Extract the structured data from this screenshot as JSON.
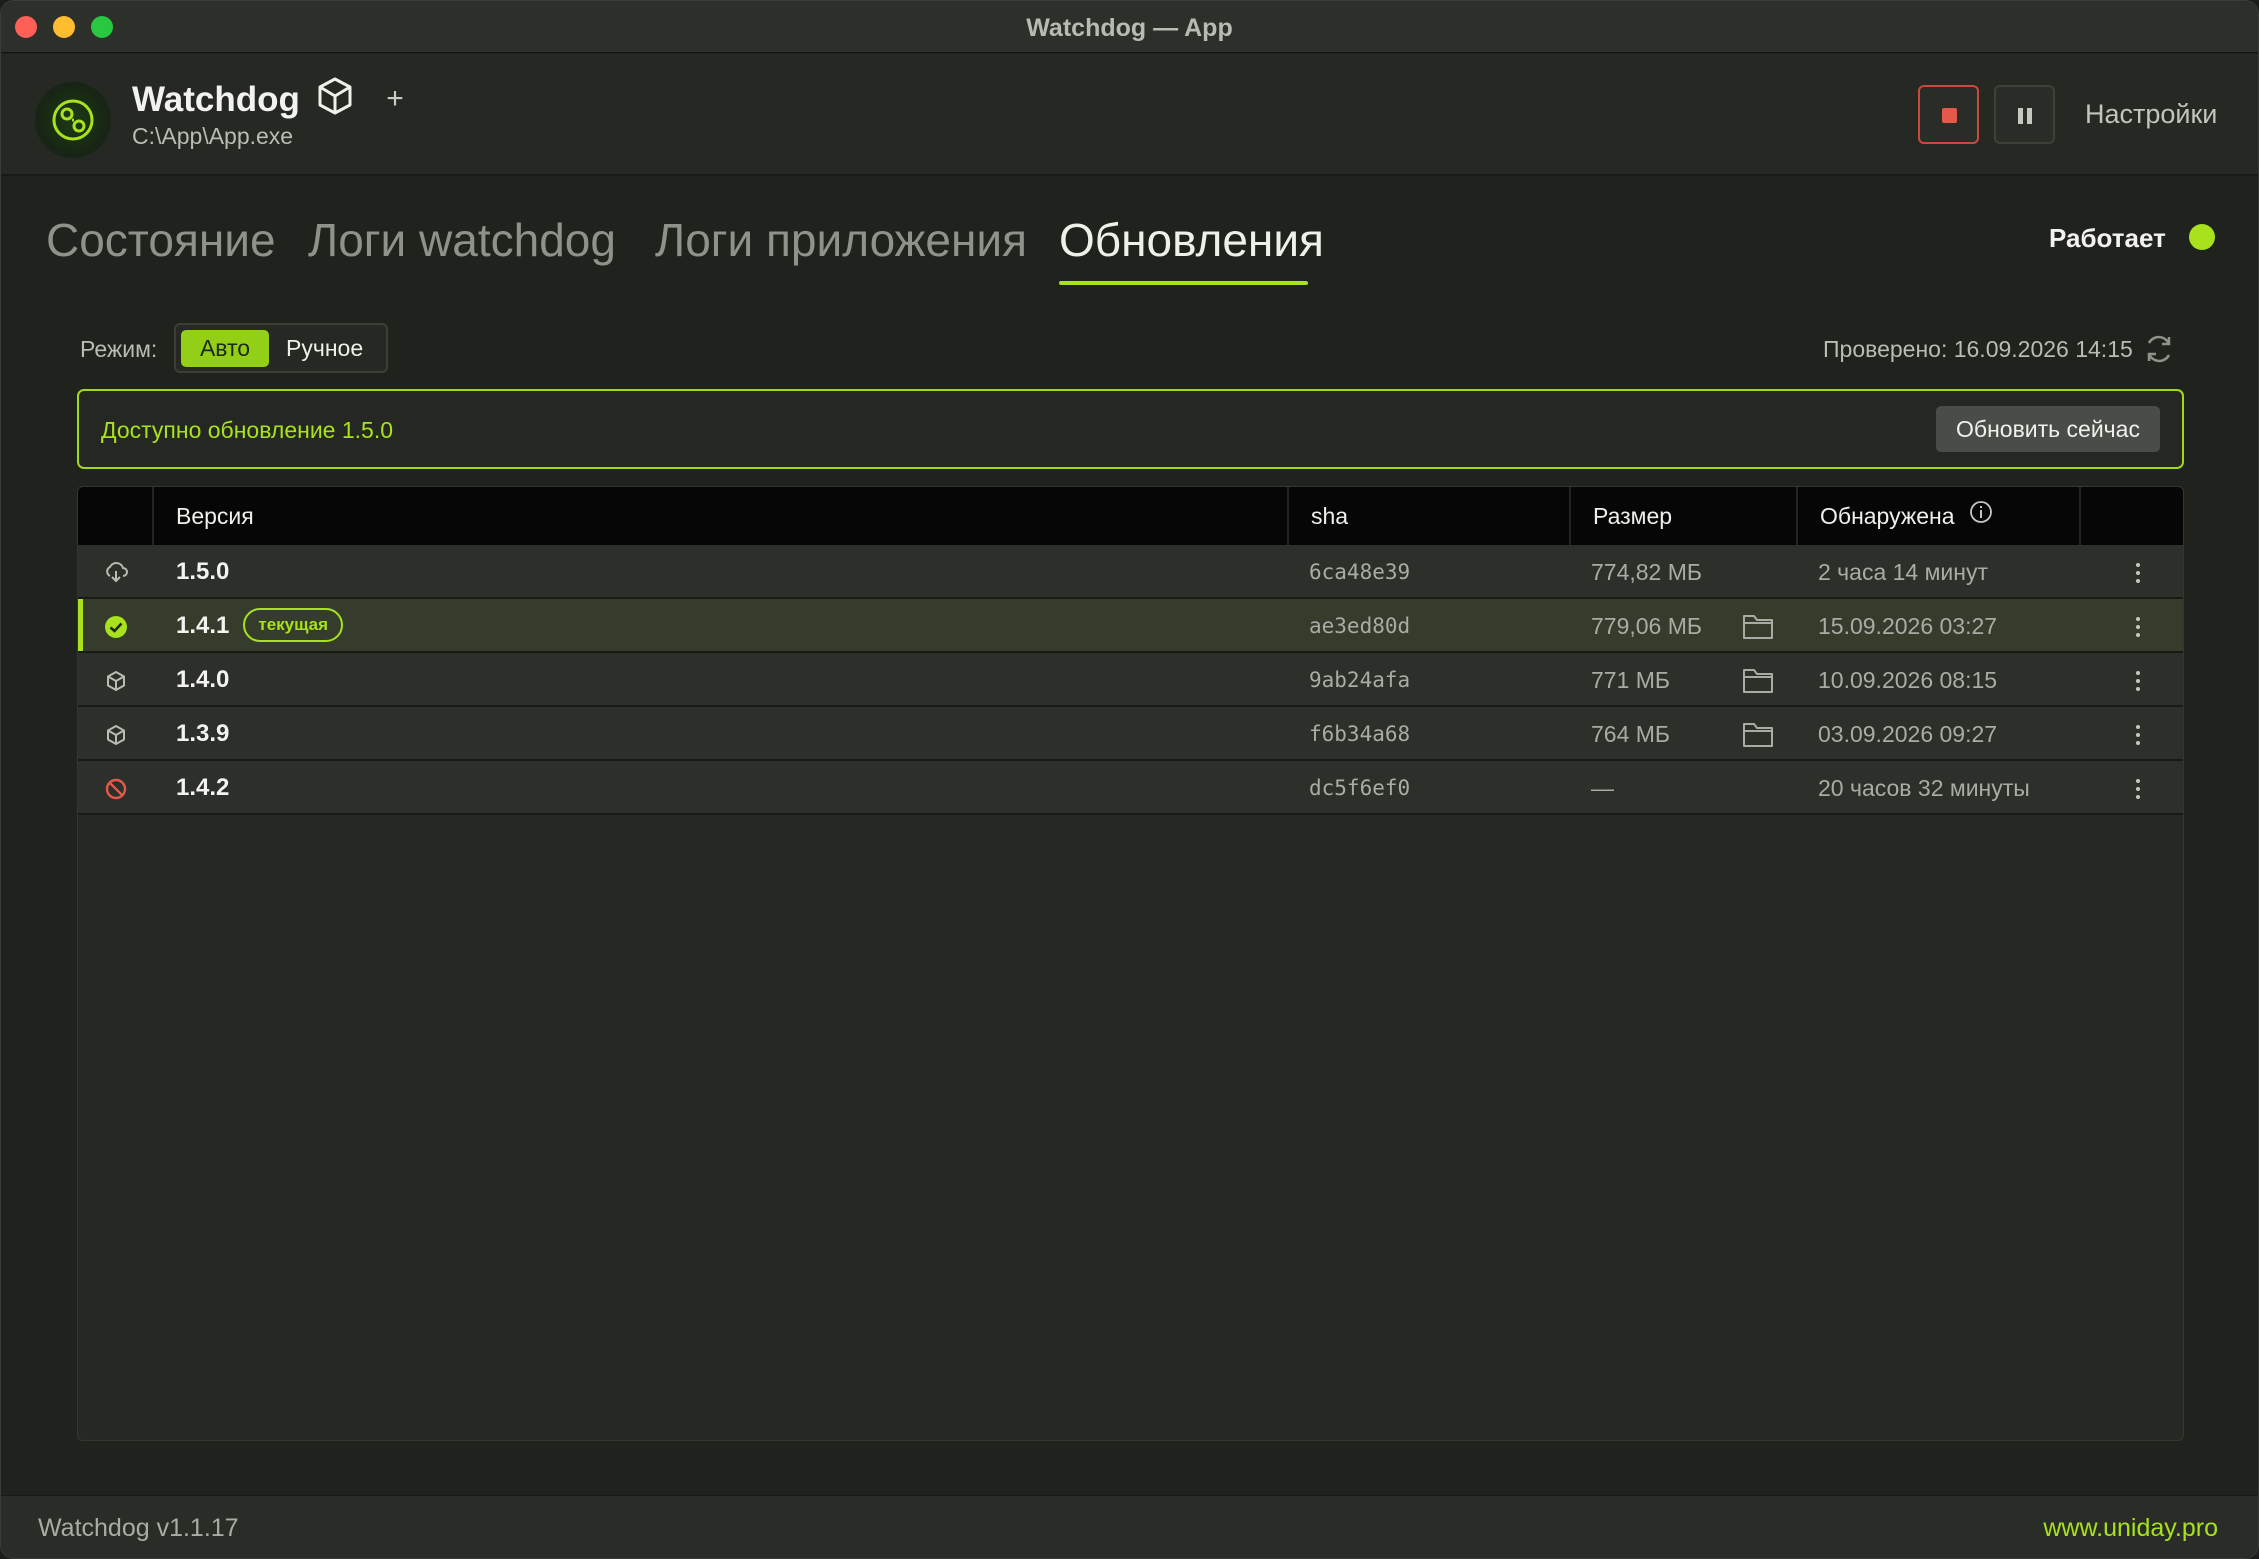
{
  "window": {
    "title": "Watchdog — App"
  },
  "header": {
    "app_name": "Watchdog",
    "app_path": "C:\\App\\App.exe",
    "add_label": "+",
    "settings_label": "Настройки"
  },
  "tabs": [
    {
      "label": "Состояние",
      "active": false
    },
    {
      "label": "Логи watchdog",
      "active": false
    },
    {
      "label": "Логи приложения",
      "active": false
    },
    {
      "label": "Обновления",
      "active": true
    }
  ],
  "status": {
    "label": "Работает",
    "color": "#a7e21c"
  },
  "mode": {
    "label": "Режим:",
    "options": [
      "Авто",
      "Ручное"
    ],
    "selected": "Авто"
  },
  "checked": {
    "label": "Проверено: 16.09.2026 14:15"
  },
  "banner": {
    "text": "Доступно обновление 1.5.0",
    "button": "Обновить сейчас"
  },
  "table": {
    "columns": [
      "Версия",
      "sha",
      "Размер",
      "Обнаружена"
    ],
    "current_badge": "текущая",
    "rows": [
      {
        "icon": "cloud-download-icon",
        "version": "1.5.0",
        "sha": "6ca48e39",
        "size": "774,82 МБ",
        "date": "2 часа 14 минут",
        "folder": false,
        "current": false
      },
      {
        "icon": "check-circle-icon",
        "version": "1.4.1",
        "sha": "ae3ed80d",
        "size": "779,06 МБ",
        "date": "15.09.2026 03:27",
        "folder": true,
        "current": true
      },
      {
        "icon": "package-icon",
        "version": "1.4.0",
        "sha": "9ab24afa",
        "size": "771 МБ",
        "date": "10.09.2026 08:15",
        "folder": true,
        "current": false
      },
      {
        "icon": "package-icon",
        "version": "1.3.9",
        "sha": "f6b34a68",
        "size": "764 МБ",
        "date": "03.09.2026 09:27",
        "folder": true,
        "current": false
      },
      {
        "icon": "blocked-icon",
        "version": "1.4.2",
        "sha": "dc5f6ef0",
        "size": "—",
        "date": "20 часов 32 минуты",
        "folder": false,
        "current": false
      }
    ]
  },
  "footer": {
    "version": "Watchdog v1.1.17",
    "link": "www.uniday.pro"
  },
  "colors": {
    "accent": "#a7e21c",
    "stop": "#e4594b",
    "background": "#1f221d"
  }
}
